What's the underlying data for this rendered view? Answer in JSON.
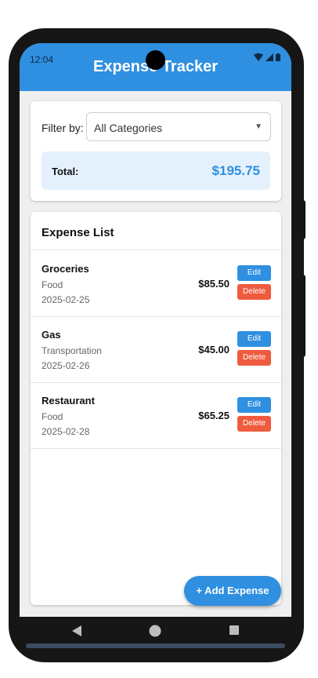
{
  "status_bar": {
    "time": "12:04"
  },
  "app_bar": {
    "title": "Expense Tracker"
  },
  "filter": {
    "label": "Filter by:",
    "selected": "All Categories"
  },
  "total": {
    "label": "Total:",
    "value": "$195.75"
  },
  "expense_list": {
    "title": "Expense List",
    "items": [
      {
        "name": "Groceries",
        "category": "Food",
        "date": "2025-02-25",
        "amount": "$85.50",
        "edit_label": "Edit",
        "delete_label": "Delete"
      },
      {
        "name": "Gas",
        "category": "Transportation",
        "date": "2025-02-26",
        "amount": "$45.00",
        "edit_label": "Edit",
        "delete_label": "Delete"
      },
      {
        "name": "Restaurant",
        "category": "Food",
        "date": "2025-02-28",
        "amount": "$65.25",
        "edit_label": "Edit",
        "delete_label": "Delete"
      }
    ]
  },
  "fab": {
    "label": "+ Add Expense"
  },
  "colors": {
    "primary": "#2f8fe0",
    "danger": "#ef5b3f",
    "total_bg": "#e4f1fc"
  },
  "nav_icons": [
    "back-icon",
    "home-icon",
    "recents-icon"
  ]
}
